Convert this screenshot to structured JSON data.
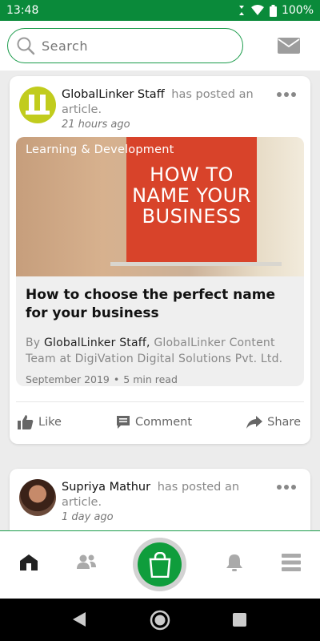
{
  "status_bar": {
    "time": "13:48",
    "battery": "100%"
  },
  "search": {
    "placeholder": "Search"
  },
  "posts": [
    {
      "author": "GlobalLinker Staff",
      "action": "has posted an article.",
      "time": "21 hours ago",
      "article": {
        "category": "Learning & Development",
        "image_text": "HOW TO NAME YOUR BUSINESS",
        "title": "How to choose the perfect name for your business",
        "by_prefix": "By ",
        "by_name": "GlobalLinker Staff,",
        "by_detail": " GlobalLinker Content Team at DigiVation Digital Solutions Pvt. Ltd.",
        "date": "September 2019",
        "read_time": "5 min read"
      },
      "actions": {
        "like": "Like",
        "comment": "Comment",
        "share": "Share"
      }
    },
    {
      "author": "Supriya Mathur",
      "action": "has posted an article.",
      "time": "1 day ago"
    }
  ],
  "colors": {
    "brand_green": "#0f9d3c",
    "status_green": "#0a8a3a",
    "banner_red": "#d8432a",
    "logo_lime": "#c1cc1d"
  },
  "icons": [
    "wifi-icon",
    "signal-icon",
    "battery-icon",
    "search-icon",
    "mail-icon",
    "more-icon",
    "like-icon",
    "comment-icon",
    "share-icon",
    "home-icon",
    "network-icon",
    "shopping-bag-icon",
    "bell-icon",
    "menu-icon",
    "back-icon",
    "home-circle-icon",
    "recents-icon"
  ]
}
